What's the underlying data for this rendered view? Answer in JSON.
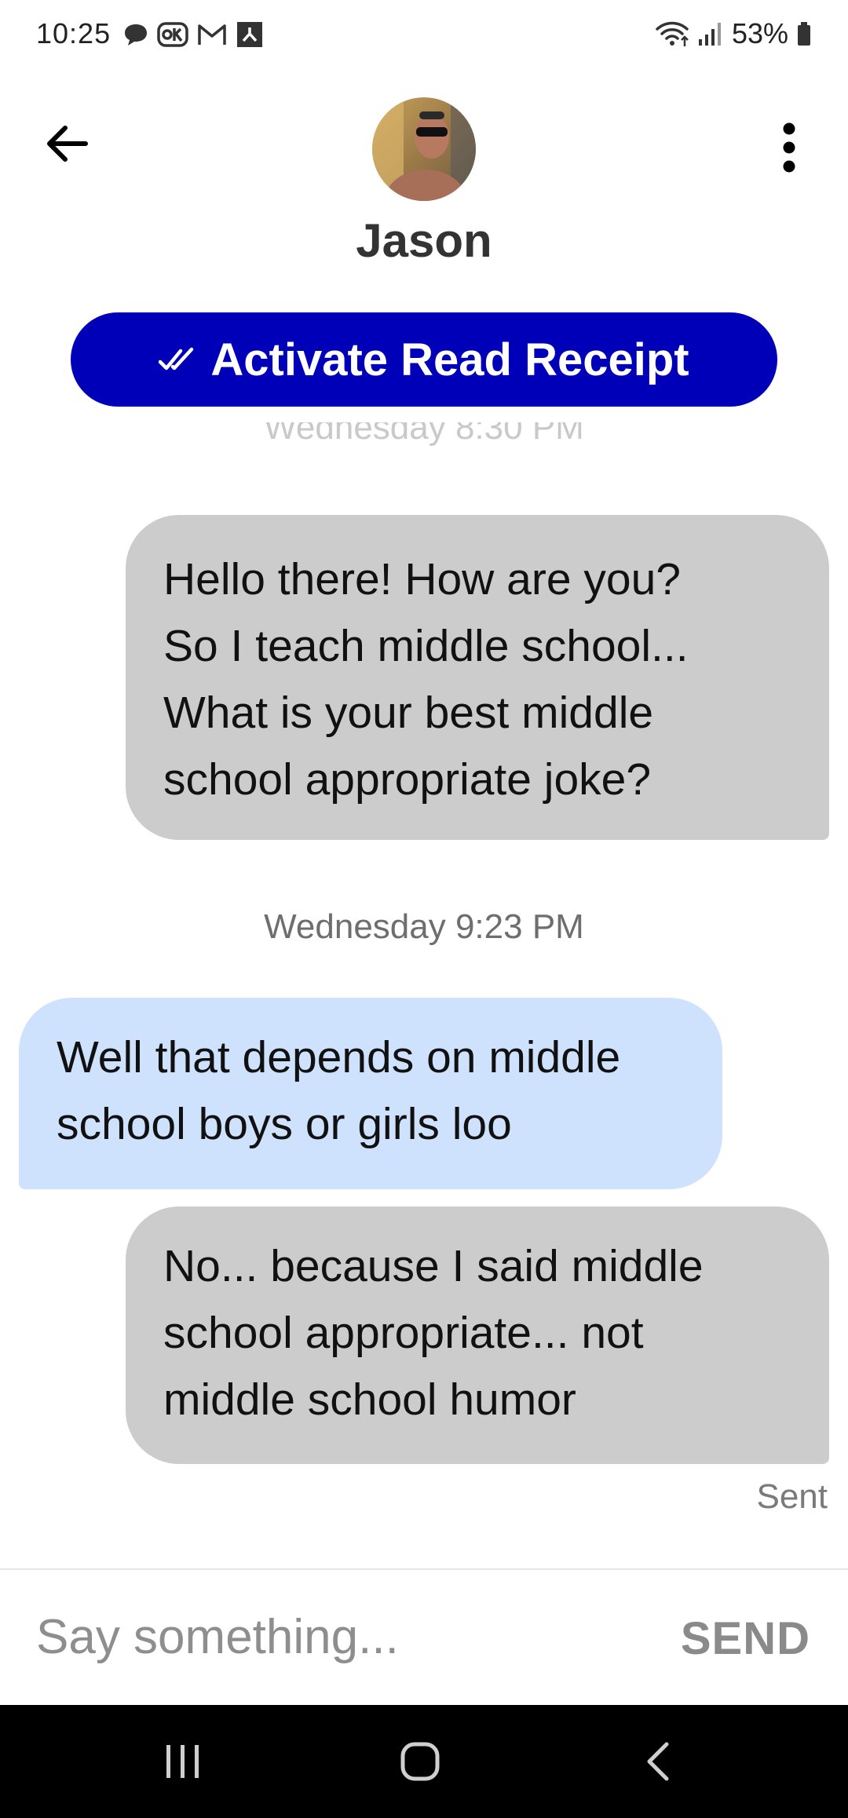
{
  "status_bar": {
    "time": "10:25",
    "battery": "53%"
  },
  "header": {
    "contact_name": "Jason",
    "back_icon": "arrow-left-icon",
    "menu_icon": "more-vertical-icon"
  },
  "receipt_button": {
    "label": "Activate Read Receipt",
    "icon": "double-check-icon",
    "color": "#0000b8"
  },
  "conversation": {
    "earlier_timestamp": "Wednesday 8:30 PM",
    "timestamp": "Wednesday 9:23 PM",
    "messages": [
      {
        "direction": "sent",
        "text": "Hello there! How are you?\nSo I teach middle school...\nWhat is your best middle\nschool appropriate joke?"
      },
      {
        "direction": "received",
        "text": "Well that depends on middle\nschool boys or girls loo"
      },
      {
        "direction": "sent",
        "text": "No... because I said middle\nschool appropriate... not\nmiddle school humor"
      }
    ],
    "delivery_status": "Sent"
  },
  "composer": {
    "placeholder": "Say something...",
    "send_label": "SEND"
  },
  "colors": {
    "sent_bubble": "#cccccc",
    "received_bubble": "#cfe2fd"
  }
}
